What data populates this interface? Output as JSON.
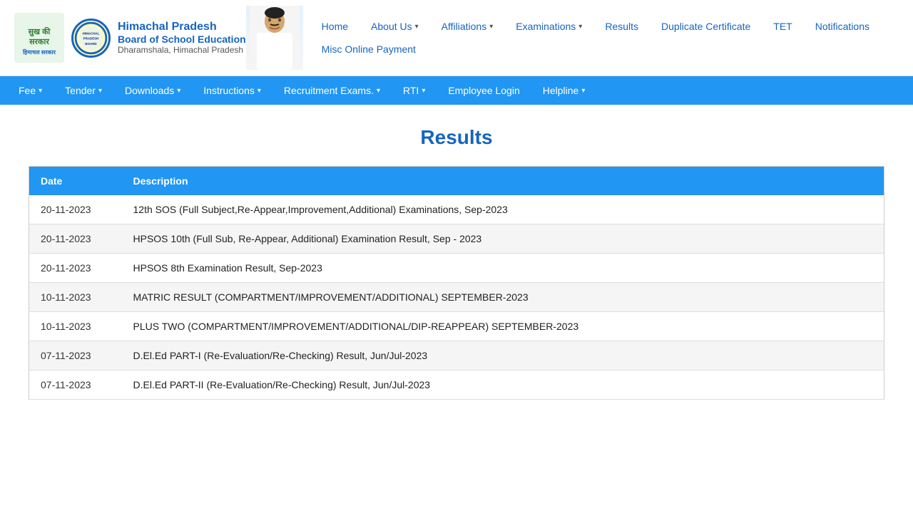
{
  "header": {
    "logo_sukh_text": "सुख की\nसरकार",
    "logo_emblem_text": "HPBOSE",
    "title1": "Himachal Pradesh",
    "title2": "Board of School Education",
    "title3": "Dharamshala, Himachal Pradesh"
  },
  "nav_top": {
    "items": [
      {
        "label": "Home",
        "has_caret": false,
        "active": true
      },
      {
        "label": "About Us",
        "has_caret": true,
        "active": false
      },
      {
        "label": "Affiliations",
        "has_caret": true,
        "active": false
      },
      {
        "label": "Examinations",
        "has_caret": true,
        "active": false
      },
      {
        "label": "Results",
        "has_caret": false,
        "active": false
      },
      {
        "label": "Duplicate Certificate",
        "has_caret": false,
        "active": false
      },
      {
        "label": "TET",
        "has_caret": false,
        "active": false
      },
      {
        "label": "Notifications",
        "has_caret": false,
        "active": false
      },
      {
        "label": "Misc Online Payment",
        "has_caret": false,
        "active": false
      }
    ]
  },
  "navbar_blue": {
    "items": [
      {
        "label": "Fee",
        "has_caret": true
      },
      {
        "label": "Tender",
        "has_caret": true
      },
      {
        "label": "Downloads",
        "has_caret": true
      },
      {
        "label": "Instructions",
        "has_caret": true
      },
      {
        "label": "Recruitment Exams.",
        "has_caret": true
      },
      {
        "label": "RTI",
        "has_caret": true
      },
      {
        "label": "Employee Login",
        "has_caret": false
      },
      {
        "label": "Helpline",
        "has_caret": true
      }
    ]
  },
  "page_title": "Results",
  "table": {
    "headers": [
      "Date",
      "Description"
    ],
    "rows": [
      {
        "date": "20-11-2023",
        "description": "12th SOS (Full Subject,Re-Appear,Improvement,Additional) Examinations, Sep-2023"
      },
      {
        "date": "20-11-2023",
        "description": "HPSOS 10th (Full Sub, Re-Appear, Additional) Examination Result, Sep - 2023"
      },
      {
        "date": "20-11-2023",
        "description": "HPSOS 8th Examination Result, Sep-2023"
      },
      {
        "date": "10-11-2023",
        "description": "MATRIC RESULT (COMPARTMENT/IMPROVEMENT/ADDITIONAL) SEPTEMBER-2023"
      },
      {
        "date": "10-11-2023",
        "description": "PLUS TWO (COMPARTMENT/IMPROVEMENT/ADDITIONAL/DIP-REAPPEAR) SEPTEMBER-2023"
      },
      {
        "date": "07-11-2023",
        "description": "D.El.Ed PART-I (Re-Evaluation/Re-Checking) Result, Jun/Jul-2023"
      },
      {
        "date": "07-11-2023",
        "description": "D.El.Ed PART-II (Re-Evaluation/Re-Checking) Result, Jun/Jul-2023"
      }
    ]
  }
}
